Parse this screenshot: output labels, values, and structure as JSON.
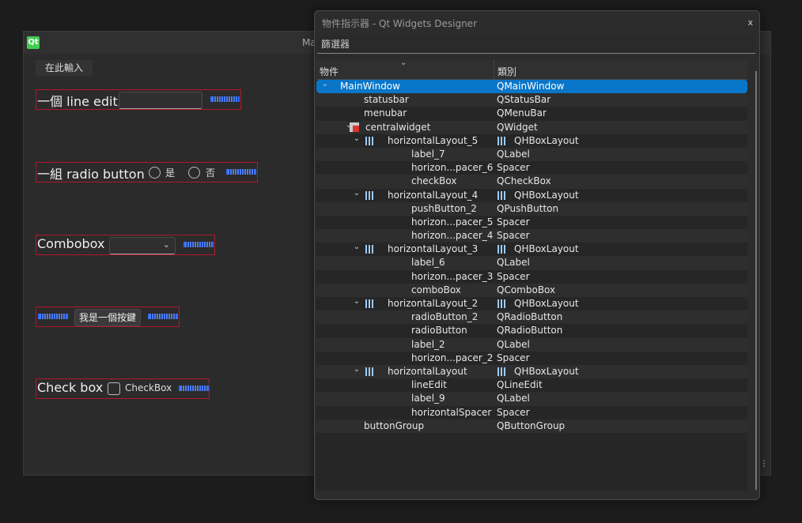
{
  "main_window": {
    "title": "Ma",
    "logo": "Qt",
    "menu_placeholder": "在此輸入",
    "form": {
      "row1": {
        "label": "一個 line edit"
      },
      "row2": {
        "label": "一組 radio button",
        "radio1": "是",
        "radio2": "否"
      },
      "row3": {
        "label": "Combobox",
        "arrow": "⌄"
      },
      "row4": {
        "button": "我是一個按鍵"
      },
      "row5": {
        "label": "Check box",
        "checkbox": "CheckBox"
      }
    }
  },
  "inspector": {
    "title": "物件指示器 - Qt Widgets Designer",
    "close": "x",
    "filter_placeholder": "篩選器",
    "col_object": "物件",
    "col_class": "類別",
    "sort_glyph": "⌄",
    "rows": [
      {
        "indent": 0,
        "exp": "⌄",
        "icon": "",
        "name": "MainWindow",
        "cls": "QMainWindow",
        "sel": true
      },
      {
        "indent": 1,
        "exp": "",
        "icon": "",
        "name": "statusbar",
        "cls": "QStatusBar"
      },
      {
        "indent": 1,
        "exp": "",
        "icon": "",
        "name": "menubar",
        "cls": "QMenuBar"
      },
      {
        "indent": 1,
        "exp": "⌄",
        "icon": "widget",
        "name": "centralwidget",
        "cls": "QWidget"
      },
      {
        "indent": 2,
        "exp": "⌄",
        "icon": "layout",
        "name": "horizontalLayout_5",
        "cls": "QHBoxLayout",
        "clsicon": true
      },
      {
        "indent": 3,
        "exp": "",
        "icon": "",
        "name": "label_7",
        "cls": "QLabel"
      },
      {
        "indent": 3,
        "exp": "",
        "icon": "",
        "name": "horizon...pacer_6",
        "cls": "Spacer"
      },
      {
        "indent": 3,
        "exp": "",
        "icon": "",
        "name": "checkBox",
        "cls": "QCheckBox"
      },
      {
        "indent": 2,
        "exp": "⌄",
        "icon": "layout",
        "name": "horizontalLayout_4",
        "cls": "QHBoxLayout",
        "clsicon": true
      },
      {
        "indent": 3,
        "exp": "",
        "icon": "",
        "name": "pushButton_2",
        "cls": "QPushButton"
      },
      {
        "indent": 3,
        "exp": "",
        "icon": "",
        "name": "horizon...pacer_5",
        "cls": "Spacer"
      },
      {
        "indent": 3,
        "exp": "",
        "icon": "",
        "name": "horizon...pacer_4",
        "cls": "Spacer"
      },
      {
        "indent": 2,
        "exp": "⌄",
        "icon": "layout",
        "name": "horizontalLayout_3",
        "cls": "QHBoxLayout",
        "clsicon": true
      },
      {
        "indent": 3,
        "exp": "",
        "icon": "",
        "name": "label_6",
        "cls": "QLabel"
      },
      {
        "indent": 3,
        "exp": "",
        "icon": "",
        "name": "horizon...pacer_3",
        "cls": "Spacer"
      },
      {
        "indent": 3,
        "exp": "",
        "icon": "",
        "name": "comboBox",
        "cls": "QComboBox"
      },
      {
        "indent": 2,
        "exp": "⌄",
        "icon": "layout",
        "name": "horizontalLayout_2",
        "cls": "QHBoxLayout",
        "clsicon": true
      },
      {
        "indent": 3,
        "exp": "",
        "icon": "",
        "name": "radioButton_2",
        "cls": "QRadioButton"
      },
      {
        "indent": 3,
        "exp": "",
        "icon": "",
        "name": "radioButton",
        "cls": "QRadioButton"
      },
      {
        "indent": 3,
        "exp": "",
        "icon": "",
        "name": "label_2",
        "cls": "QLabel"
      },
      {
        "indent": 3,
        "exp": "",
        "icon": "",
        "name": "horizon...pacer_2",
        "cls": "Spacer"
      },
      {
        "indent": 2,
        "exp": "⌄",
        "icon": "layout",
        "name": "horizontalLayout",
        "cls": "QHBoxLayout",
        "clsicon": true
      },
      {
        "indent": 3,
        "exp": "",
        "icon": "",
        "name": "lineEdit",
        "cls": "QLineEdit"
      },
      {
        "indent": 3,
        "exp": "",
        "icon": "",
        "name": "label_9",
        "cls": "QLabel"
      },
      {
        "indent": 3,
        "exp": "",
        "icon": "",
        "name": "horizontalSpacer",
        "cls": "Spacer"
      },
      {
        "indent": 1,
        "exp": "",
        "icon": "",
        "name": "buttonGroup",
        "cls": "QButtonGroup"
      }
    ]
  },
  "colors": {
    "selection": "#0a76c9",
    "layout_border": "#b0182c",
    "spacer": "#2d6dff",
    "qt_green": "#41cd52"
  }
}
